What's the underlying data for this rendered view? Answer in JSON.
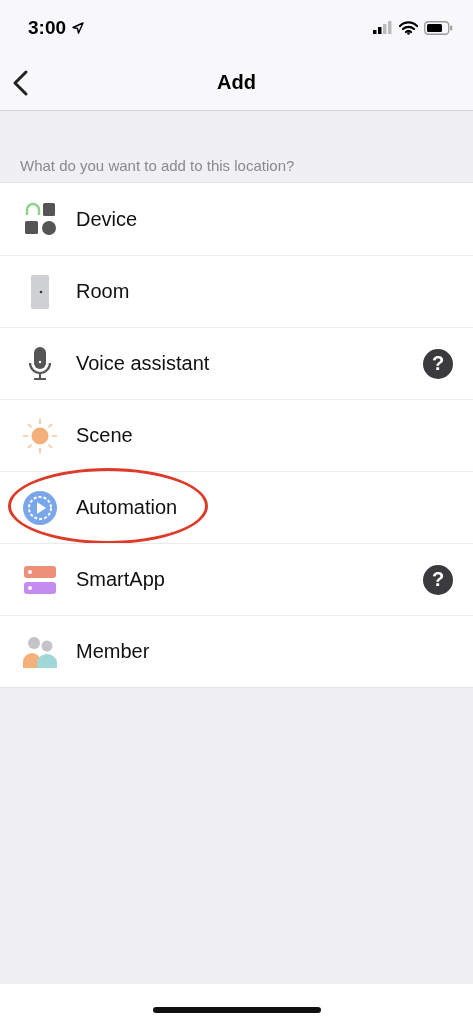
{
  "status_bar": {
    "time": "3:00"
  },
  "nav": {
    "title": "Add"
  },
  "section_header": "What do you want to add to this location?",
  "items": [
    {
      "kind": "device",
      "label": "Device",
      "circled": false
    },
    {
      "kind": "room",
      "label": "Room",
      "circled": false
    },
    {
      "kind": "voice",
      "label": "Voice assistant",
      "help": "?",
      "circled": false
    },
    {
      "kind": "scene",
      "label": "Scene",
      "circled": false
    },
    {
      "kind": "automation",
      "label": "Automation",
      "circled": true
    },
    {
      "kind": "smartapp",
      "label": "SmartApp",
      "help": "?",
      "circled": false
    },
    {
      "kind": "member",
      "label": "Member",
      "circled": false
    }
  ]
}
